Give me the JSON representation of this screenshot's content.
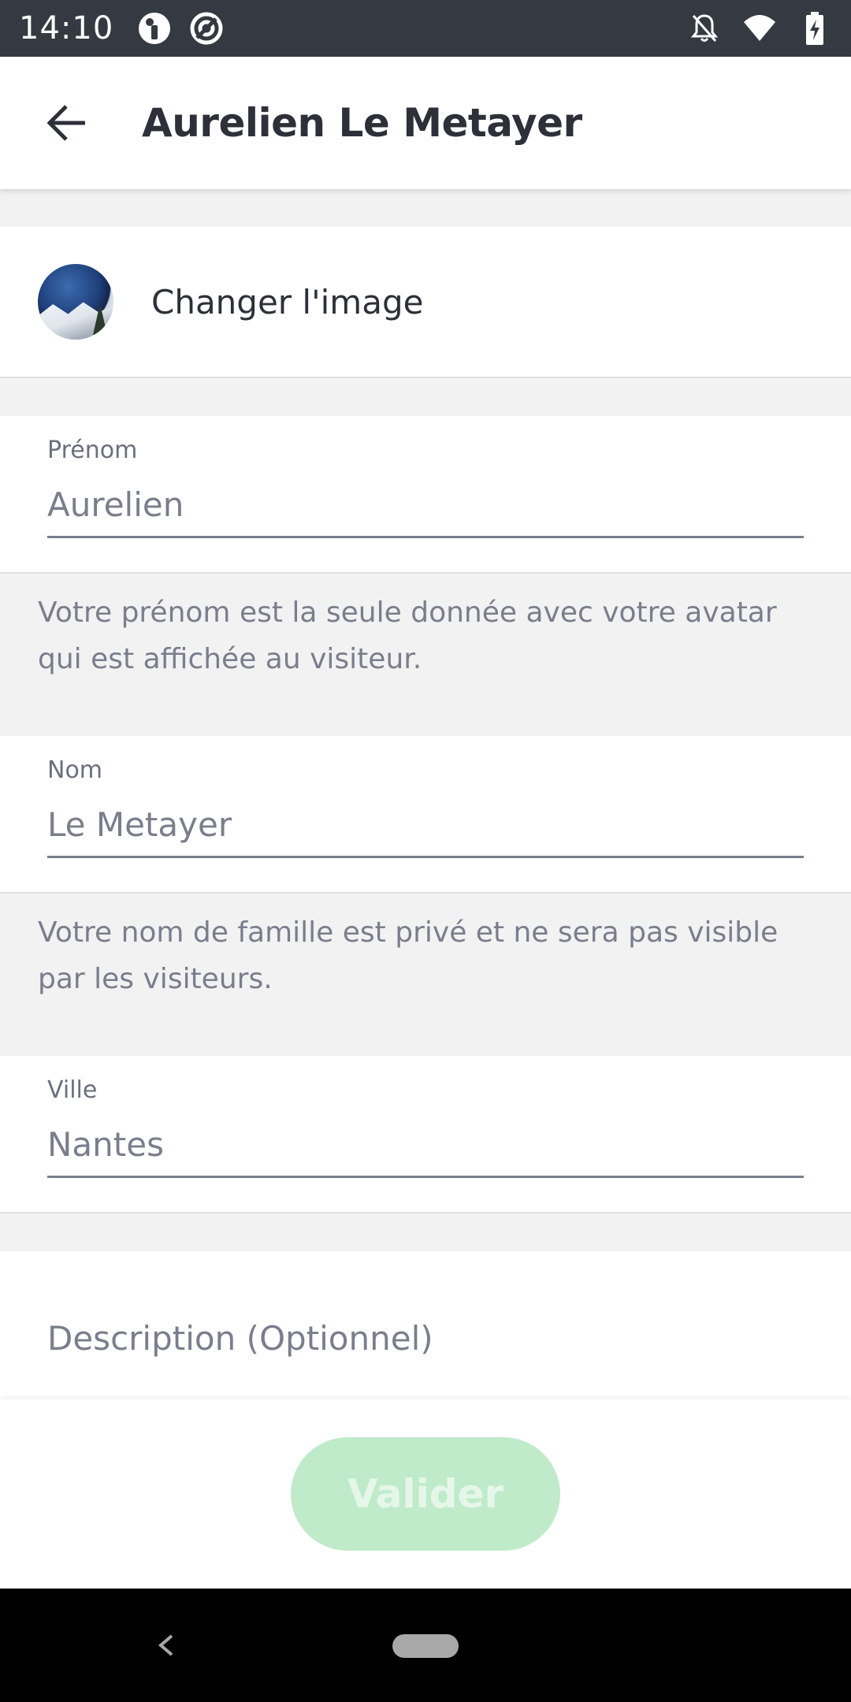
{
  "status_bar": {
    "time": "14:10",
    "icons": [
      "notification-app-icon",
      "sync-icon",
      "notifications-off-icon",
      "wifi-icon",
      "battery-charging-icon"
    ]
  },
  "app_bar": {
    "title": "Aurelien Le Metayer",
    "back_icon": "arrow-left-icon"
  },
  "avatar_section": {
    "change_image_label": "Changer l'image"
  },
  "fields": {
    "first_name": {
      "label": "Prénom",
      "value": "Aurelien",
      "helper": "Votre prénom est la seule donnée avec votre avatar qui est affichée au visiteur."
    },
    "last_name": {
      "label": "Nom",
      "value": "Le Metayer",
      "helper": "Votre nom de famille est privé et ne sera pas visible par les visiteurs."
    },
    "city": {
      "label": "Ville",
      "value": "Nantes"
    },
    "description": {
      "placeholder": "Description (Optionnel)"
    }
  },
  "actions": {
    "validate_label": "Valider"
  },
  "colors": {
    "status_bar": "#353941",
    "validate_disabled": "#c0ebcb",
    "text_primary": "#2d3038",
    "text_secondary": "#7a7e8c"
  }
}
